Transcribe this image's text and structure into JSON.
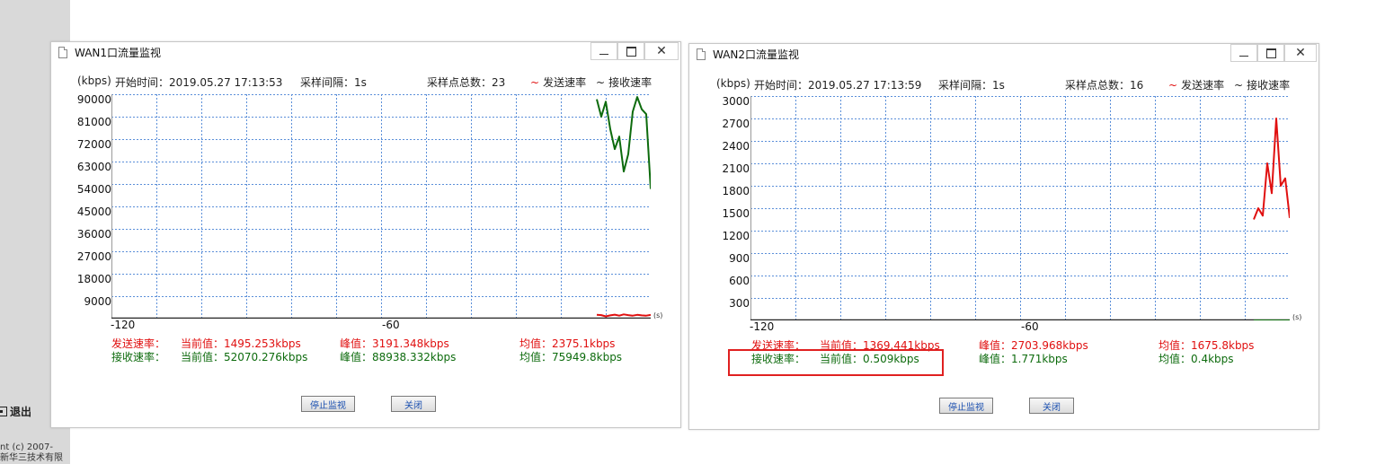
{
  "sidebar": {
    "logout_label": "退出",
    "copyright_line1": "nt (c) 2007-",
    "copyright_line2": "新华三技术有限"
  },
  "windows": [
    {
      "title": "WAN1口流量监视",
      "unit_label": "(kbps)",
      "start_time": "开始时间：2019.05.27 17:13:53",
      "interval": "采样间隔：1s",
      "sample_count": "采样点总数：23",
      "legend_send": "发送速率",
      "legend_recv": "接收速率",
      "legend_glyph": "~",
      "y_ticks": [
        "90000",
        "81000",
        "72000",
        "63000",
        "54000",
        "45000",
        "36000",
        "27000",
        "18000",
        "9000"
      ],
      "x_ticks": [
        "-120",
        "-60"
      ],
      "x_unit": "(s)",
      "send_row": {
        "label": "发送速率：",
        "current": "当前值：1495.253kbps",
        "peak": "峰值：3191.348kbps",
        "avg": "均值：2375.1kbps"
      },
      "recv_row": {
        "label": "接收速率：",
        "current": "当前值：52070.276kbps",
        "peak": "峰值：88938.332kbps",
        "avg": "均值：75949.8kbps"
      },
      "stop_button": "停止监视",
      "close_button": "关闭"
    },
    {
      "title": "WAN2口流量监视",
      "unit_label": "(kbps)",
      "start_time": "开始时间：2019.05.27 17:13:59",
      "interval": "采样间隔：1s",
      "sample_count": "采样点总数：16",
      "legend_send": "发送速率",
      "legend_recv": "接收速率",
      "legend_glyph": "~",
      "y_ticks": [
        "3000",
        "2700",
        "2400",
        "2100",
        "1800",
        "1500",
        "1200",
        "900",
        "600",
        "300"
      ],
      "x_ticks": [
        "-120",
        "-60"
      ],
      "x_unit": "(s)",
      "send_row": {
        "label": "发送速率：",
        "current": "当前值：1369.441kbps",
        "peak": "峰值：2703.968kbps",
        "avg": "均值：1675.8kbps"
      },
      "recv_row": {
        "label": "接收速率：",
        "current": "当前值：0.509kbps",
        "peak": "峰值：1.771kbps",
        "avg": "均值：0.4kbps"
      },
      "stop_button": "停止监视",
      "close_button": "关闭"
    }
  ],
  "colors": {
    "send": "#e01010",
    "recv": "#0d6b0d",
    "grid": "#5b8fd9",
    "highlight": "#e02020"
  },
  "chart_data": [
    {
      "type": "line",
      "ylabel": "(kbps)",
      "ylim": [
        0,
        90000
      ],
      "xlim": [
        -120,
        0
      ],
      "series": [
        {
          "name": "发送速率",
          "x": [
            -12,
            -11,
            -10,
            -9,
            -8,
            -7,
            -6,
            -5,
            -4,
            -3,
            -2,
            -1,
            0
          ],
          "values": [
            1500,
            1400,
            900,
            1300,
            1600,
            1200,
            1700,
            1400,
            1200,
            1500,
            1300,
            1200,
            1495
          ]
        },
        {
          "name": "接收速率",
          "x": [
            -12,
            -11,
            -10,
            -9,
            -8,
            -7,
            -6,
            -5,
            -4,
            -3,
            -2,
            -1,
            0
          ],
          "values": [
            88000,
            81000,
            87000,
            76000,
            68000,
            73000,
            59000,
            66000,
            83000,
            88900,
            84000,
            82000,
            52000
          ]
        }
      ]
    },
    {
      "type": "line",
      "ylabel": "(kbps)",
      "ylim": [
        0,
        3000
      ],
      "xlim": [
        -120,
        0
      ],
      "series": [
        {
          "name": "发送速率",
          "x": [
            -8,
            -7,
            -6,
            -5,
            -4,
            -3,
            -2,
            -1,
            0
          ],
          "values": [
            1350,
            1500,
            1400,
            2100,
            1700,
            2700,
            1800,
            1900,
            1369
          ]
        },
        {
          "name": "接收速率",
          "x": [
            -8,
            0
          ],
          "values": [
            0.4,
            0.509
          ]
        }
      ]
    }
  ]
}
